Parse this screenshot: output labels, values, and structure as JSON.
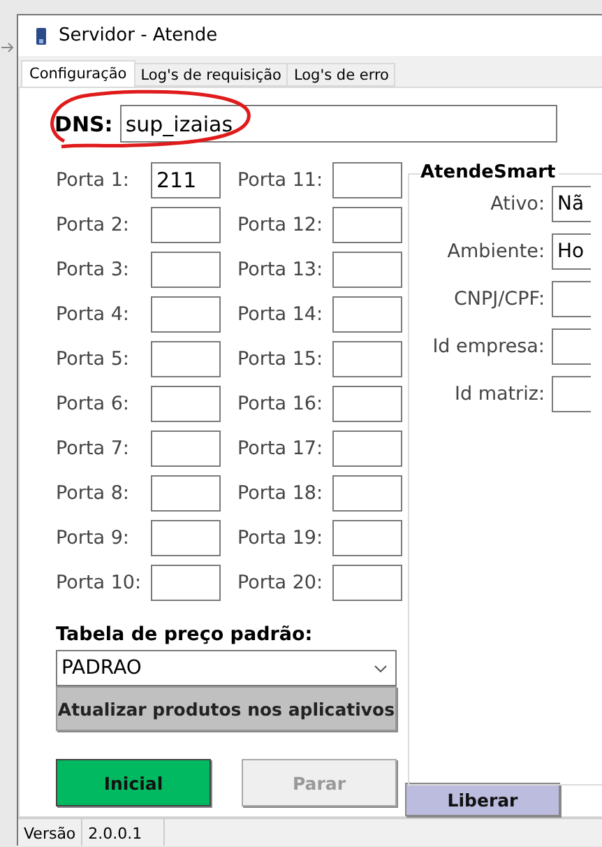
{
  "window": {
    "title": "Servidor - Atende"
  },
  "tabs": [
    {
      "label": "Configuração",
      "selected": true
    },
    {
      "label": "Log's de requisição",
      "selected": false
    },
    {
      "label": "Log's de erro",
      "selected": false
    }
  ],
  "dns": {
    "label": "DNS:",
    "value": "sup_izaias"
  },
  "ports": [
    {
      "label": "Porta 1:",
      "value": "211"
    },
    {
      "label": "Porta 2:"
    },
    {
      "label": "Porta 3:"
    },
    {
      "label": "Porta 4:"
    },
    {
      "label": "Porta 5:"
    },
    {
      "label": "Porta 6:"
    },
    {
      "label": "Porta 7:"
    },
    {
      "label": "Porta 8:"
    },
    {
      "label": "Porta 9:"
    },
    {
      "label": "Porta 10:"
    },
    {
      "label": "Porta 11:"
    },
    {
      "label": "Porta 12:"
    },
    {
      "label": "Porta 13:"
    },
    {
      "label": "Porta 14:"
    },
    {
      "label": "Porta 15:"
    },
    {
      "label": "Porta 16:"
    },
    {
      "label": "Porta 17:"
    },
    {
      "label": "Porta 18:"
    },
    {
      "label": "Porta 19:"
    },
    {
      "label": "Porta 20:"
    }
  ],
  "atende_smart": {
    "title": "AtendeSmart",
    "fields": [
      {
        "label": "Ativo:",
        "value": "Nã"
      },
      {
        "label": "Ambiente:",
        "value": "Ho"
      },
      {
        "label": "CNPJ/CPF:"
      },
      {
        "label": "Id empresa:"
      },
      {
        "label": "Id matriz:"
      }
    ]
  },
  "price_table": {
    "label": "Tabela de preço padrão:",
    "value": "PADRAO"
  },
  "buttons": [
    {
      "label": "Atualizar produtos nos aplicativos",
      "kind": "update",
      "disabled": false
    },
    {
      "label": "Inicial",
      "kind": "start",
      "disabled": false
    },
    {
      "label": "Parar",
      "kind": "stop",
      "disabled": true
    },
    {
      "label": "Liberar",
      "kind": "release",
      "disabled": false
    }
  ],
  "status_bar": {
    "label": "Versão",
    "value": "2.0.0.1"
  }
}
